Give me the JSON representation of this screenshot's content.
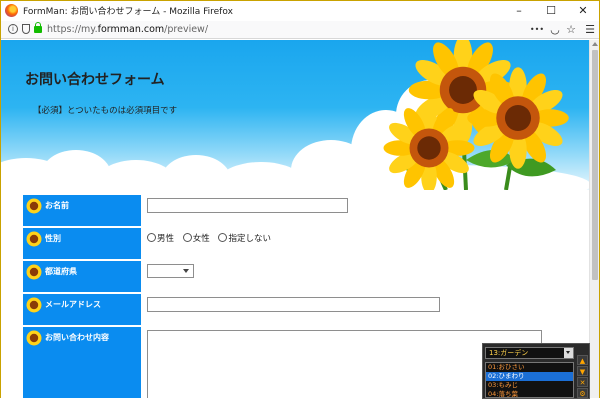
{
  "window": {
    "title": "FormMan: お問い合わせフォーム - Mozilla Firefox",
    "minimize": "–",
    "maximize": "☐",
    "close": "✕"
  },
  "navbar": {
    "url_prefix": "https://my.",
    "url_domain": "formman.com",
    "url_path": "/preview/",
    "more_glyph": "•••",
    "pocket_glyph": "◡",
    "bookmark_glyph": "☆",
    "menu_glyph": "☰"
  },
  "hero": {
    "title": "お問い合わせフォーム",
    "note": "【必須】とついたものは必須項目です"
  },
  "form": {
    "rows": [
      {
        "label": "お名前",
        "type": "text"
      },
      {
        "label": "性別",
        "type": "radio",
        "options": [
          "男性",
          "女性",
          "指定しない"
        ]
      },
      {
        "label": "都道府県",
        "type": "select",
        "value": ""
      },
      {
        "label": "メールアドレス",
        "type": "text"
      },
      {
        "label": "お問い合わせ内容",
        "type": "textarea"
      }
    ]
  },
  "palette": {
    "selected": "13:ガーデン",
    "items": [
      "01:おひさい",
      "02:ひまわり",
      "03:もみじ",
      "04:落ち葉"
    ],
    "selected_index": 1,
    "buttons": [
      "▲",
      "▼",
      "✕",
      "⚙"
    ]
  },
  "colors": {
    "label_bg": "#0a8cf0",
    "sky_top": "#1aa6ee",
    "lock_green": "#12bc00"
  }
}
